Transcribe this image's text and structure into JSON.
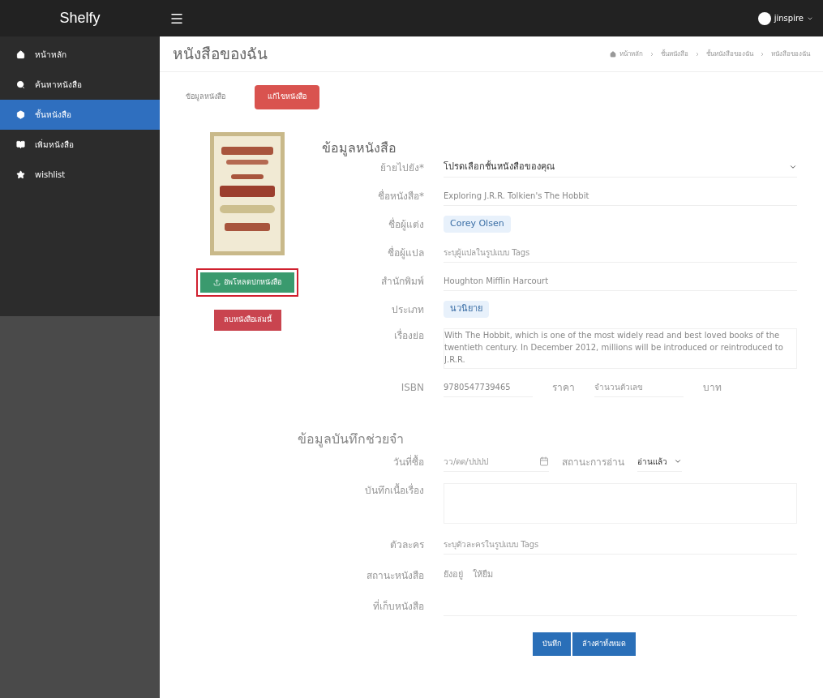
{
  "header": {
    "brand": "Shelfy",
    "user": "jinspire"
  },
  "sidebar": {
    "items": [
      {
        "label": "หน้าหลัก",
        "selected": false
      },
      {
        "label": "ค้นหาหนังสือ",
        "selected": false
      },
      {
        "label": "ชั้นหนังสือ",
        "selected": true
      },
      {
        "label": "เพิ่มหนังสือ",
        "selected": false
      },
      {
        "label": "wishlist",
        "selected": false
      }
    ]
  },
  "page": {
    "title": "หนังสือของฉัน",
    "breadcrumb": [
      "หน้าหลัก",
      "ชั้นหนังสือ",
      "ชั้นหนังสือของฉัน",
      "หนังสือของฉัน"
    ]
  },
  "tabs": [
    {
      "label": "ข้อมูลหนังสือ",
      "selected": false
    },
    {
      "label": "แก้ไขหนังสือ",
      "selected": true
    }
  ],
  "cover": {
    "kind": "picture",
    "upload_button": "อัพโหลดปกหนังสือ",
    "upload_highlighted": true,
    "delete_button": "ลบหนังสือเล่มนี้"
  },
  "book_section": {
    "title": "ข้อมูลหนังสือ",
    "fields": [
      {
        "kind": "select",
        "label": "ย้ายไปยัง*",
        "value": "โปรดเลือกชั้นหนังสือของคุณ"
      },
      {
        "kind": "input",
        "label": "ชื่อหนังสือ*",
        "value": "Exploring J.R.R. Tolkien's The Hobbit"
      },
      {
        "kind": "tags",
        "label": "ชื่อผู้แต่ง",
        "tags": [
          "Corey Olsen"
        ]
      },
      {
        "kind": "input",
        "label": "ชื่อผู้แปล",
        "placeholder": "ระบุผู้แปลในรูปแบบ Tags"
      },
      {
        "kind": "input",
        "label": "สำนักพิมพ์",
        "value": "Houghton Mifflin Harcourt"
      },
      {
        "kind": "tags",
        "label": "ประเภท",
        "tags": [
          "นวนิยาย"
        ]
      },
      {
        "kind": "textarea",
        "label": "เรื่องย่อ",
        "value": "With The Hobbit, which is one of the most widely read and best loved books of the twentieth century. In December 2012, millions will be introduced or reintroduced to J.R.R."
      },
      {
        "kind": "isbn",
        "label": "ISBN",
        "value": "9780547739465",
        "price_label": "ราคา",
        "price_placeholder": "จำนวนตัวเลข",
        "unit": "บาท"
      }
    ]
  },
  "memo_section": {
    "title": "ข้อมูลบันทึกช่วยจำ",
    "fields": [
      {
        "kind": "date",
        "label": "วันที่ซื้อ",
        "placeholder": "วว/ดด/ปปปป",
        "status_label": "สถานะการอ่าน",
        "status_value": "อ่านแล้ว"
      },
      {
        "kind": "textarea",
        "label": "บันทึกเนื้อเรื่อง"
      },
      {
        "kind": "input",
        "label": "ตัวละคร",
        "placeholder": "ระบุตัวละครในรูปแบบ Tags"
      },
      {
        "kind": "options",
        "label": "สถานะหนังสือ",
        "options": [
          "ยังอยู่",
          "ให้ยืม"
        ]
      },
      {
        "kind": "input",
        "label": "ที่เก็บหนังสือ"
      }
    ]
  },
  "actions": [
    "บันทึก",
    "ล้างค่าทั้งหมด"
  ]
}
